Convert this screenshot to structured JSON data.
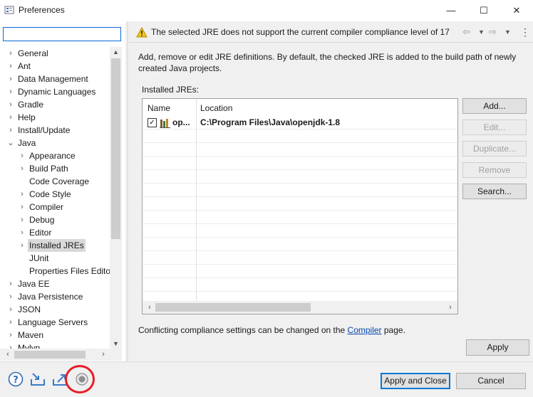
{
  "window": {
    "title": "Preferences",
    "controls": {
      "minimize": "—",
      "maximize": "☐",
      "close": "✕"
    }
  },
  "filter": {
    "value": ""
  },
  "tree": [
    {
      "label": "General",
      "level": 0,
      "expander": "collapsed"
    },
    {
      "label": "Ant",
      "level": 0,
      "expander": "collapsed"
    },
    {
      "label": "Data Management",
      "level": 0,
      "expander": "collapsed"
    },
    {
      "label": "Dynamic Languages",
      "level": 0,
      "expander": "collapsed"
    },
    {
      "label": "Gradle",
      "level": 0,
      "expander": "collapsed"
    },
    {
      "label": "Help",
      "level": 0,
      "expander": "collapsed"
    },
    {
      "label": "Install/Update",
      "level": 0,
      "expander": "collapsed"
    },
    {
      "label": "Java",
      "level": 0,
      "expander": "expanded"
    },
    {
      "label": "Appearance",
      "level": 1,
      "expander": "collapsed"
    },
    {
      "label": "Build Path",
      "level": 1,
      "expander": "collapsed"
    },
    {
      "label": "Code Coverage",
      "level": 1,
      "expander": "none"
    },
    {
      "label": "Code Style",
      "level": 1,
      "expander": "collapsed"
    },
    {
      "label": "Compiler",
      "level": 1,
      "expander": "collapsed"
    },
    {
      "label": "Debug",
      "level": 1,
      "expander": "collapsed"
    },
    {
      "label": "Editor",
      "level": 1,
      "expander": "collapsed"
    },
    {
      "label": "Installed JREs",
      "level": 1,
      "expander": "collapsed",
      "selected": true
    },
    {
      "label": "JUnit",
      "level": 1,
      "expander": "none"
    },
    {
      "label": "Properties Files Edito",
      "level": 1,
      "expander": "none"
    },
    {
      "label": "Java EE",
      "level": 0,
      "expander": "collapsed"
    },
    {
      "label": "Java Persistence",
      "level": 0,
      "expander": "collapsed"
    },
    {
      "label": "JSON",
      "level": 0,
      "expander": "collapsed"
    },
    {
      "label": "Language Servers",
      "level": 0,
      "expander": "collapsed"
    },
    {
      "label": "Maven",
      "level": 0,
      "expander": "collapsed"
    },
    {
      "label": "Mylyn",
      "level": 0,
      "expander": "collapsed"
    }
  ],
  "message": {
    "icon": "warning-icon",
    "text": "The selected JRE does not support the current compiler compliance level of 17"
  },
  "page": {
    "description": "Add, remove or edit JRE definitions. By default, the checked JRE is added to the build path of newly created Java projects.",
    "installed_label": "Installed JREs:",
    "columns": [
      "Name",
      "Location"
    ],
    "jres": [
      {
        "checked": true,
        "name": "op...",
        "location": "C:\\Program Files\\Java\\openjdk-1.8"
      }
    ],
    "buttons": {
      "add": "Add...",
      "edit": "Edit...",
      "duplicate": "Duplicate...",
      "remove": "Remove",
      "search": "Search..."
    },
    "conflict_prefix": "Conflicting compliance settings can be changed on the ",
    "conflict_link": "Compiler",
    "conflict_suffix": " page.",
    "apply": "Apply"
  },
  "bottom": {
    "apply_and_close": "Apply and Close",
    "cancel": "Cancel",
    "icons": [
      "help-icon",
      "import-icon",
      "export-icon",
      "record-icon"
    ]
  },
  "colors": {
    "accent": "#0078d7",
    "highlight_circle": "#e81c24",
    "link": "#0645ad"
  }
}
